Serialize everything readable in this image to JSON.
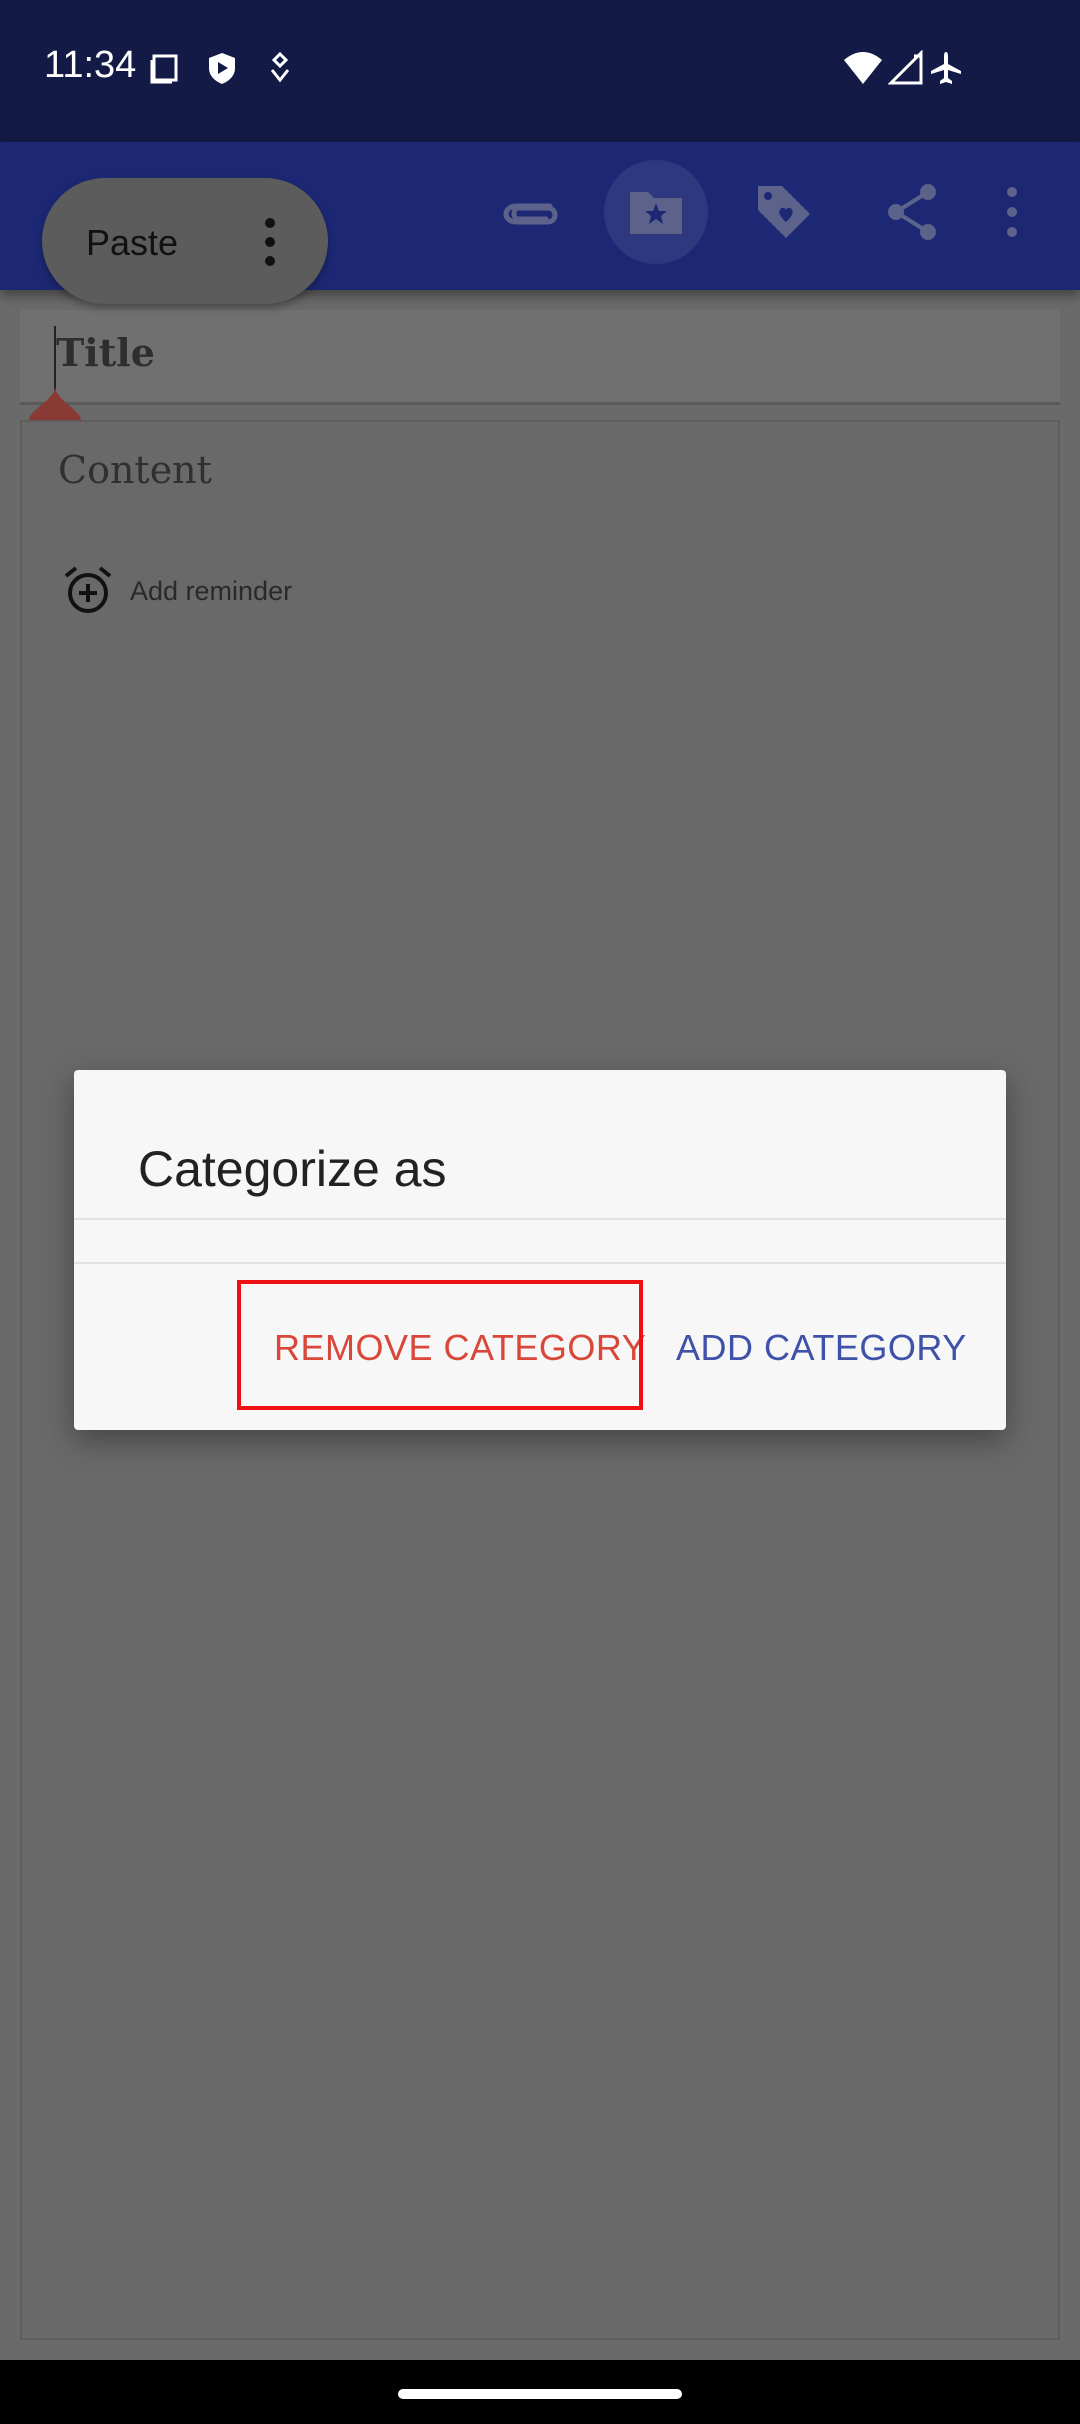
{
  "status_bar": {
    "time": "11:34",
    "icons": [
      "screenshot-icon",
      "shield-icon",
      "location-icon",
      "wifi-icon",
      "signal-icon",
      "airplane-icon"
    ]
  },
  "selection_menu": {
    "paste_label": "Paste",
    "more_icon": "more-vert-icon"
  },
  "toolbar": {
    "icons": [
      "attachment-icon",
      "category-icon",
      "tag-icon",
      "share-icon",
      "more-vert-icon"
    ],
    "active": "category-icon"
  },
  "editor": {
    "title_placeholder": "Title",
    "content_placeholder": "Content",
    "reminder_label": "Add reminder"
  },
  "dialog": {
    "title": "Categorize as",
    "remove_button": "REMOVE CATEGORY",
    "add_button": "ADD CATEGORY"
  },
  "colors": {
    "status_bar": "#131a45",
    "toolbar": "#1c2874",
    "remove_text": "#d9473a",
    "add_text": "#3f51a8",
    "highlight": "#ee1111"
  }
}
